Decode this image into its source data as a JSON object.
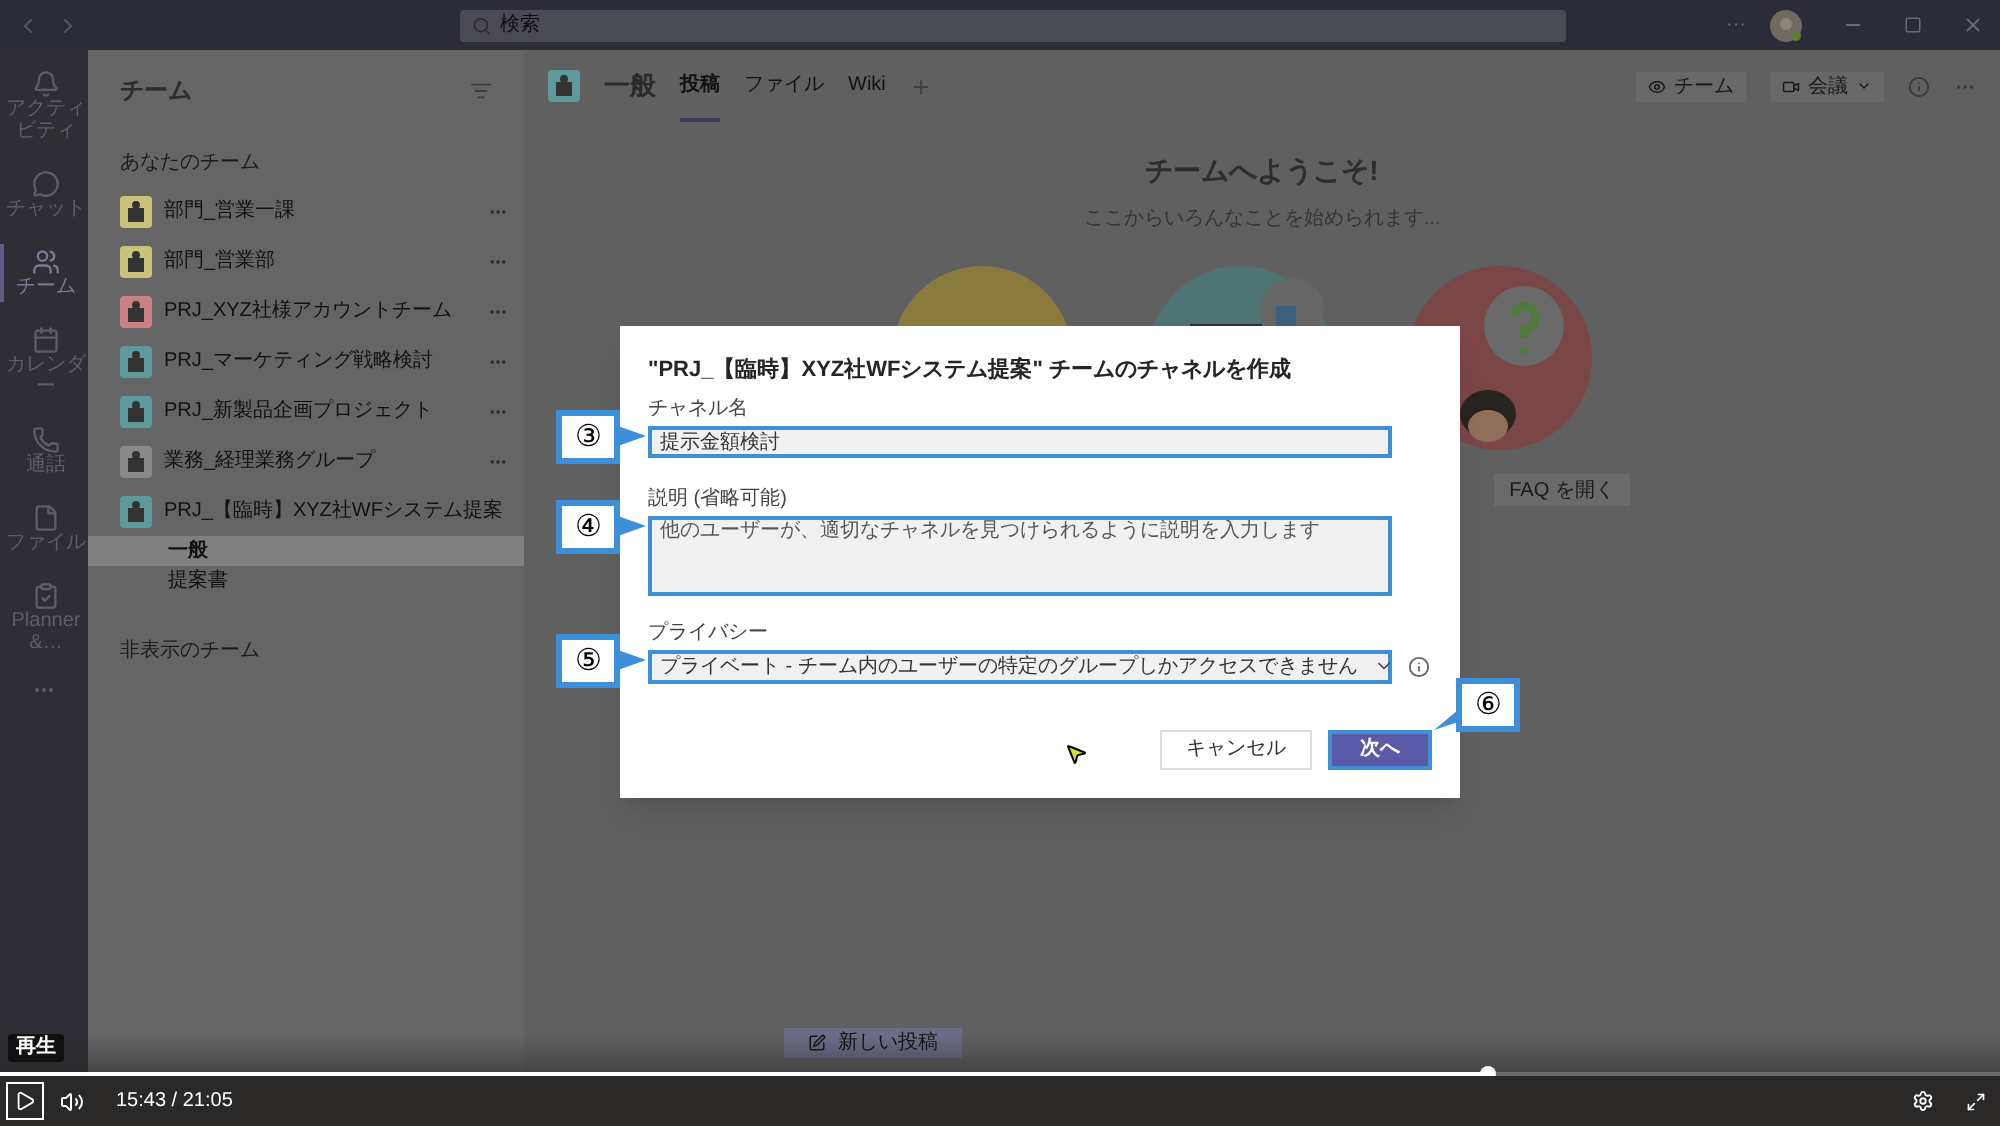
{
  "title_bar": {
    "search": {
      "placeholder": "検索"
    },
    "more": "···"
  },
  "app_bar": {
    "items": [
      {
        "label": "アクティビティ",
        "selected": false
      },
      {
        "label": "チャット",
        "selected": false
      },
      {
        "label": "チーム",
        "selected": true
      },
      {
        "label": "カレンダー",
        "selected": false
      },
      {
        "label": "通話",
        "selected": false
      },
      {
        "label": "ファイル",
        "selected": false
      },
      {
        "label": "Planner &…",
        "selected": false
      }
    ]
  },
  "sidebar": {
    "title": "チーム",
    "sections": [
      {
        "heading": "あなたのチーム",
        "teams": [
          {
            "name": "部門_営業一課",
            "color": "#c8c27a"
          },
          {
            "name": "部門_営業部",
            "color": "#c8c27a"
          },
          {
            "name": "PRJ_XYZ社様アカウントチーム",
            "color": "#c98080"
          },
          {
            "name": "PRJ_マーケティング戦略検討",
            "color": "#5f9a9a"
          },
          {
            "name": "PRJ_新製品企画プロジェクト",
            "color": "#5f9a9a"
          },
          {
            "name": "業務_経理業務グループ",
            "color": "#8a8a8a"
          },
          {
            "name": "PRJ_【臨時】XYZ社WFシステム提案",
            "color": "#5f9a9a",
            "channels": [
              {
                "name": "一般",
                "selected": true
              },
              {
                "name": "提案書",
                "selected": false
              }
            ]
          }
        ]
      },
      {
        "heading": "非表示のチーム"
      }
    ]
  },
  "channel_header": {
    "name": "一般",
    "tabs": [
      {
        "label": "投稿",
        "selected": true
      },
      {
        "label": "ファイル",
        "selected": false
      },
      {
        "label": "Wiki",
        "selected": false
      }
    ],
    "actions": [
      {
        "label": "チーム"
      },
      {
        "label": "会議"
      }
    ]
  },
  "welcome": {
    "title": "チームへようこそ!",
    "subtitle": "ここからいろんなことを始められます...",
    "faq_button": "FAQ を開く"
  },
  "compose": {
    "new_post_button": "新しい投稿"
  },
  "dialog": {
    "title": "\"PRJ_【臨時】XYZ社WFシステム提案\" チームのチャネルを作成",
    "fields": [
      {
        "kind": "text",
        "label": "チャネル名",
        "value": "提示金額検討",
        "callout": "③"
      },
      {
        "kind": "textarea",
        "label": "説明 (省略可能)",
        "placeholder": "他のユーザーが、適切なチャネルを見つけられるように説明を入力します",
        "callout": "④"
      },
      {
        "kind": "select",
        "label": "プライバシー",
        "value": "プライベート - チーム内のユーザーの特定のグループしかアクセスできません",
        "callout": "⑤"
      }
    ],
    "buttons": [
      {
        "kind": "secondary",
        "label": "キャンセル"
      },
      {
        "kind": "primary",
        "label": "次へ",
        "callout": "⑥"
      }
    ]
  },
  "player": {
    "tooltip": "再生",
    "playing": false,
    "progress": {
      "level": 0.744
    },
    "time": "15:43 / 21:05"
  }
}
